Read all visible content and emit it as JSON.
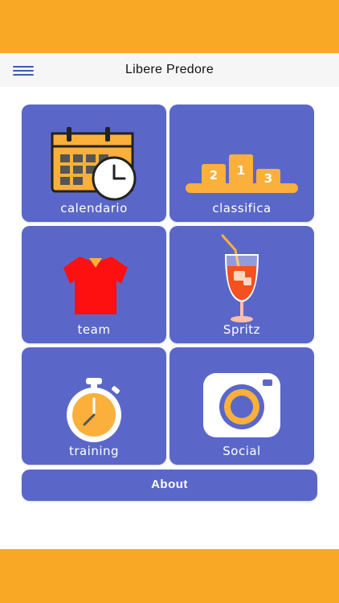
{
  "header": {
    "title": "Libere Predore",
    "menu_icon": "hamburger-icon"
  },
  "tiles": [
    {
      "label": "calendario",
      "icon": "calendar-clock-icon"
    },
    {
      "label": "classifica",
      "icon": "podium-icon",
      "podium": [
        "2",
        "1",
        "3"
      ]
    },
    {
      "label": "team",
      "icon": "jersey-icon"
    },
    {
      "label": "Spritz",
      "icon": "spritz-glass-icon"
    },
    {
      "label": "training",
      "icon": "stopwatch-icon"
    },
    {
      "label": "Social",
      "icon": "camera-icon"
    }
  ],
  "about": {
    "label": "About"
  },
  "colors": {
    "accent": "#F9A825",
    "tile": "#5A67C8",
    "jersey": "#FF1010"
  }
}
